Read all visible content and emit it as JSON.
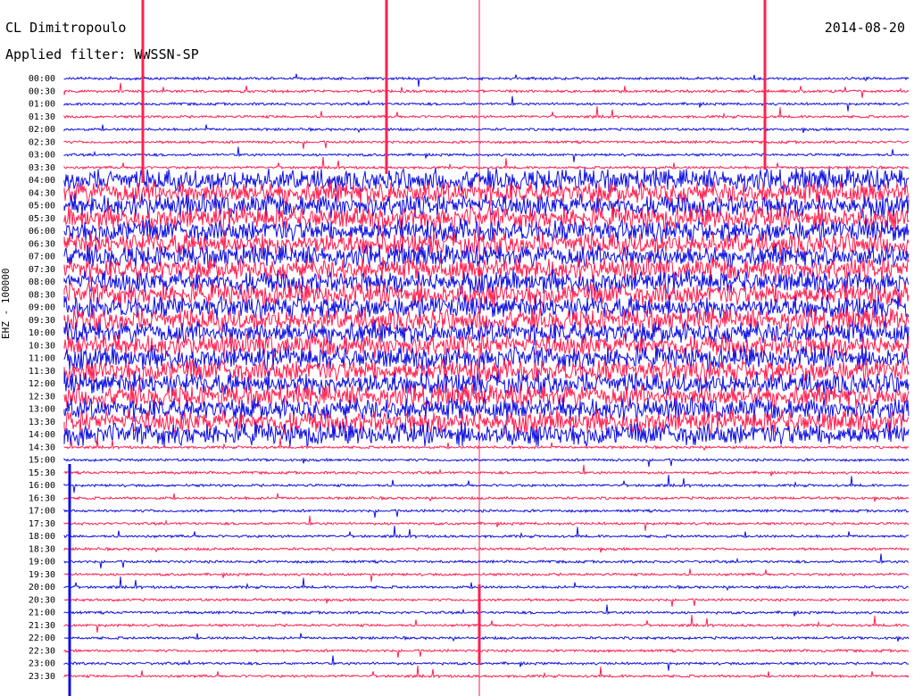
{
  "header": {
    "station": "CL Dimitropoulo",
    "filter": "Applied filter: WWSSN-SP",
    "date": "2014-08-20"
  },
  "axis_label": "EHZ - 100000",
  "colors": {
    "odd": "#1010e0",
    "even": "#ff2050"
  },
  "chart_data": {
    "type": "line",
    "title": "CL Dimitropoulo",
    "date": "2014-08-20",
    "filter": "WWSSN-SP",
    "ylabel": "EHZ - 100000",
    "row_labels": [
      "00:00",
      "00:30",
      "01:00",
      "01:30",
      "02:00",
      "02:30",
      "03:00",
      "03:30",
      "04:00",
      "04:30",
      "05:00",
      "05:30",
      "06:00",
      "06:30",
      "07:00",
      "07:30",
      "08:00",
      "08:30",
      "09:00",
      "09:30",
      "10:00",
      "10:30",
      "11:00",
      "11:30",
      "12:00",
      "12:30",
      "13:00",
      "13:30",
      "14:00",
      "14:30",
      "15:00",
      "15:30",
      "16:00",
      "16:30",
      "17:00",
      "17:30",
      "18:00",
      "18:30",
      "19:00",
      "19:30",
      "20:00",
      "20:30",
      "21:00",
      "21:30",
      "22:00",
      "22:30",
      "23:00",
      "23:30"
    ],
    "noisy_rows": {
      "start": "04:00",
      "end": "14:00"
    }
  }
}
